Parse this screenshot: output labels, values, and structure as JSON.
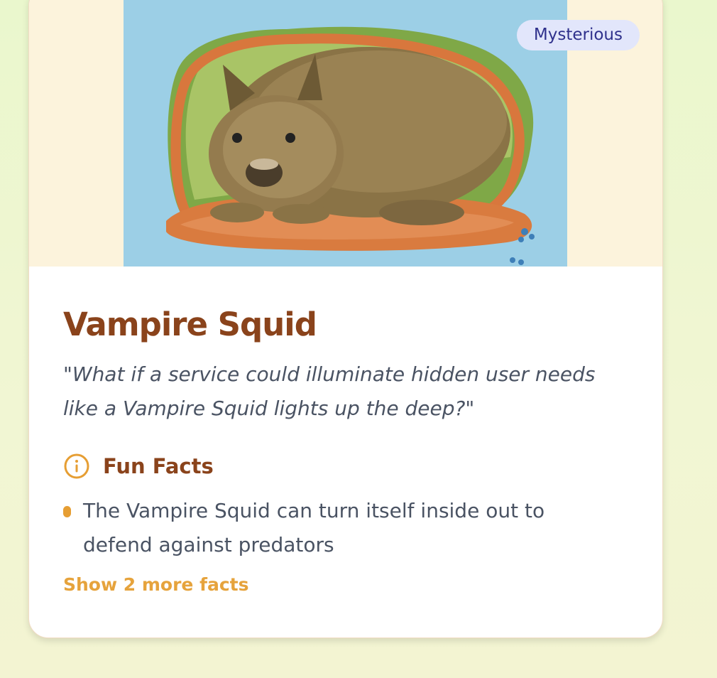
{
  "card": {
    "badge": "Mysterious",
    "title": "Vampire Squid",
    "quote": "\"What if a service could illuminate hidden user needs like a Vampire Squid lights up the deep?\"",
    "facts_heading": "Fun Facts",
    "facts": [
      "The Vampire Squid can turn itself inside out to defend against predators"
    ],
    "show_more": "Show 2 more facts"
  },
  "colors": {
    "title": "#8a431b",
    "accent": "#e69e33",
    "badge_bg": "#e2e6fb",
    "badge_text": "#2f318c",
    "image_bg": "#9ccfe6",
    "hero_bg": "#fcf3dc"
  },
  "icons": {
    "facts_heading": "info-icon",
    "bullet": "bullet-dot"
  }
}
